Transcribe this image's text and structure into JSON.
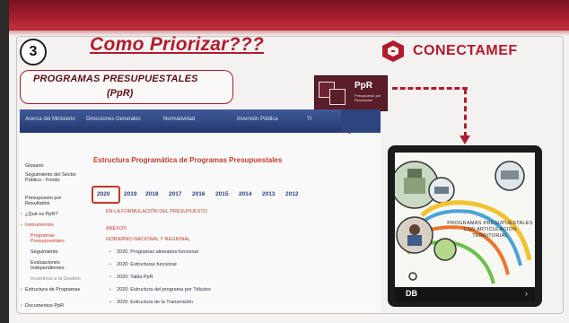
{
  "slide": {
    "step_number": "3",
    "title": "Como Priorizar???",
    "subject_line1": "PROGRAMAS PRESUPUESTALES",
    "subject_line2": "(PpR)",
    "brand": "CONECTAMEF",
    "brand_color": "#b01c2e"
  },
  "ppr_badge": {
    "label": "PpR",
    "sublabel": "Presupuesto por Resultados"
  },
  "website": {
    "nav": [
      "Acerca del Ministerio",
      "Direcciones Generales",
      "Normatividad",
      "Inversión Pública",
      "Tr"
    ],
    "sidebar": [
      {
        "label": "Glosario",
        "style": "normal"
      },
      {
        "label": "Seguimiento del Sector Público - Fondo",
        "style": "normal"
      },
      {
        "label": "Presupuesto por Resultados",
        "style": "normal"
      },
      {
        "label": "¿Qué es PpR?",
        "style": "normal"
      },
      {
        "label": "Instrumentos",
        "style": "red"
      },
      {
        "label": "Programas Presupuestales",
        "style": "red"
      },
      {
        "label": "Seguimiento",
        "style": "normal"
      },
      {
        "label": "Evaluaciones Independientes",
        "style": "normal"
      },
      {
        "label": "Incentivos a la Gestión",
        "style": "light"
      },
      {
        "label": "Estructura de Programas",
        "style": "normal"
      },
      {
        "label": "Documentos PpR",
        "style": "normal"
      }
    ],
    "content_title": "Estructura Programática de Programas Presupuestales",
    "years": [
      "2020",
      "2019",
      "2018",
      "2017",
      "2016",
      "2015",
      "2014",
      "2013",
      "2012"
    ],
    "year_link": "EN LA FORMULACIÓN DEL PRESUPUESTO",
    "section_a": "ANEXOS",
    "section_b": "GOBIERNO NACIONAL Y REGIONAL",
    "list_items": [
      "2020: Programas alineados funcional",
      "2020: Estructuras funcional",
      "2020: Tabla PpR",
      "2020: Estructura del programa por Tributos",
      "2020: Estructura de la Transmisión"
    ]
  },
  "tablet": {
    "title": "PROGRAMAS PRESUPUESTALES CON ARTICULACIÓN TERRITORIAL",
    "brand": "DB"
  }
}
